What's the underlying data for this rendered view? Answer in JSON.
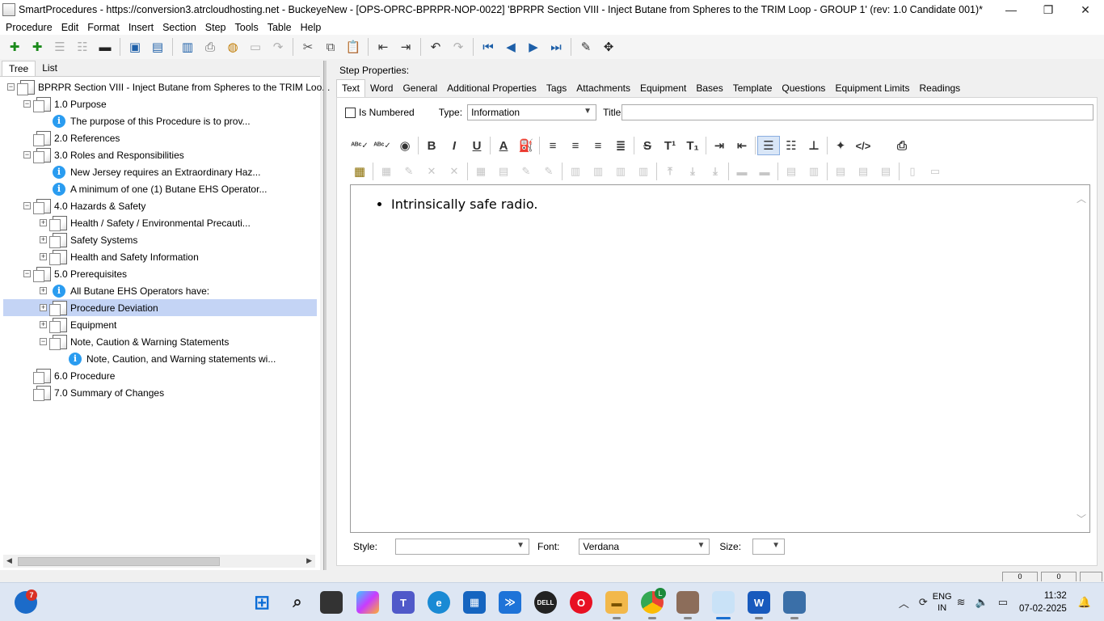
{
  "window": {
    "title": "SmartProcedures - https://conversion3.atrcloudhosting.net - BuckeyeNew - [OPS-OPRC-BPRPR-NOP-0022] 'BPRPR Section VIII - Inject Butane from Spheres to the TRIM Loop - GROUP 1' (rev: 1.0 Candidate 001)*",
    "minimize": "—",
    "restore": "❐",
    "close": "✕"
  },
  "menu": [
    "Procedure",
    "Edit",
    "Format",
    "Insert",
    "Section",
    "Step",
    "Tools",
    "Table",
    "Help"
  ],
  "left_tabs": [
    "Tree",
    "List"
  ],
  "tree": [
    {
      "label": "BPRPR Section VIII - Inject Butane from Spheres to the TRIM Loo...",
      "toggle": "−",
      "icon": "page"
    },
    {
      "label": "1.0 Purpose",
      "toggle": "−",
      "icon": "page"
    },
    {
      "label": "The purpose of this Procedure is to prov...",
      "toggle": "",
      "icon": "info"
    },
    {
      "label": "2.0 References",
      "toggle": "",
      "icon": "page"
    },
    {
      "label": "3.0 Roles and Responsibilities",
      "toggle": "−",
      "icon": "page"
    },
    {
      "label": "New Jersey requires an Extraordinary Haz...",
      "toggle": "",
      "icon": "info"
    },
    {
      "label": "A minimum of one (1) Butane EHS Operator...",
      "toggle": "",
      "icon": "info"
    },
    {
      "label": "4.0 Hazards & Safety",
      "toggle": "−",
      "icon": "page"
    },
    {
      "label": "Health / Safety / Environmental Precauti...",
      "toggle": "+",
      "icon": "page"
    },
    {
      "label": "Safety Systems",
      "toggle": "+",
      "icon": "page"
    },
    {
      "label": "Health and Safety Information",
      "toggle": "+",
      "icon": "page"
    },
    {
      "label": "5.0 Prerequisites",
      "toggle": "−",
      "icon": "page"
    },
    {
      "label": "All Butane EHS Operators have:",
      "toggle": "+",
      "icon": "info"
    },
    {
      "label": "Procedure Deviation",
      "toggle": "+",
      "icon": "page"
    },
    {
      "label": "Equipment",
      "toggle": "+",
      "icon": "page"
    },
    {
      "label": "Note, Caution & Warning Statements",
      "toggle": "−",
      "icon": "page"
    },
    {
      "label": "Note, Caution, and Warning statements wi...",
      "toggle": "",
      "icon": "info"
    },
    {
      "label": "6.0 Procedure",
      "toggle": "",
      "icon": "page"
    },
    {
      "label": "7.0 Summary of Changes",
      "toggle": "",
      "icon": "page"
    }
  ],
  "step_properties": {
    "label": "Step Properties:",
    "tabs": [
      "Text",
      "Word",
      "General",
      "Additional Properties",
      "Tags",
      "Attachments",
      "Equipment",
      "Bases",
      "Template",
      "Questions",
      "Equipment Limits",
      "Readings"
    ],
    "is_numbered_label": "Is Numbered",
    "type_label": "Type:",
    "type_value": "Information",
    "title_label": "Title:",
    "title_value": ""
  },
  "editor": {
    "bullets": [
      "Intrinsically safe radio."
    ]
  },
  "bottom": {
    "style_label": "Style:",
    "style_value": "",
    "font_label": "Font:",
    "font_value": "Verdana",
    "size_label": "Size:",
    "size_value": ""
  },
  "statusbar": [
    "0",
    "0"
  ],
  "taskbar": {
    "notification_count": "7",
    "chrome_badge": "L",
    "lang_line1": "ENG",
    "lang_line2": "IN",
    "time": "11:32",
    "date": "07-02-2025"
  }
}
